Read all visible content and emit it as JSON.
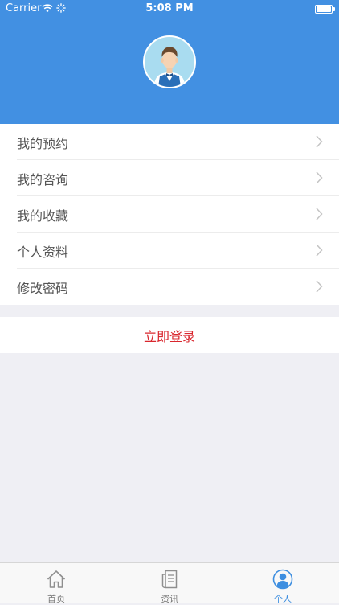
{
  "status_bar": {
    "carrier": "Carrier",
    "time": "5:08 PM"
  },
  "colors": {
    "header": "#4290e2",
    "accent": "#3d8ee0",
    "login": "#d9272e"
  },
  "menu": {
    "items": [
      {
        "label": "我的预约"
      },
      {
        "label": "我的咨询"
      },
      {
        "label": "我的收藏"
      },
      {
        "label": "个人资料"
      },
      {
        "label": "修改密码"
      }
    ]
  },
  "login_button": "立即登录",
  "tabs": [
    {
      "label": "首页",
      "icon": "home-icon"
    },
    {
      "label": "资讯",
      "icon": "news-icon"
    },
    {
      "label": "个人",
      "icon": "person-icon",
      "active": true
    }
  ]
}
